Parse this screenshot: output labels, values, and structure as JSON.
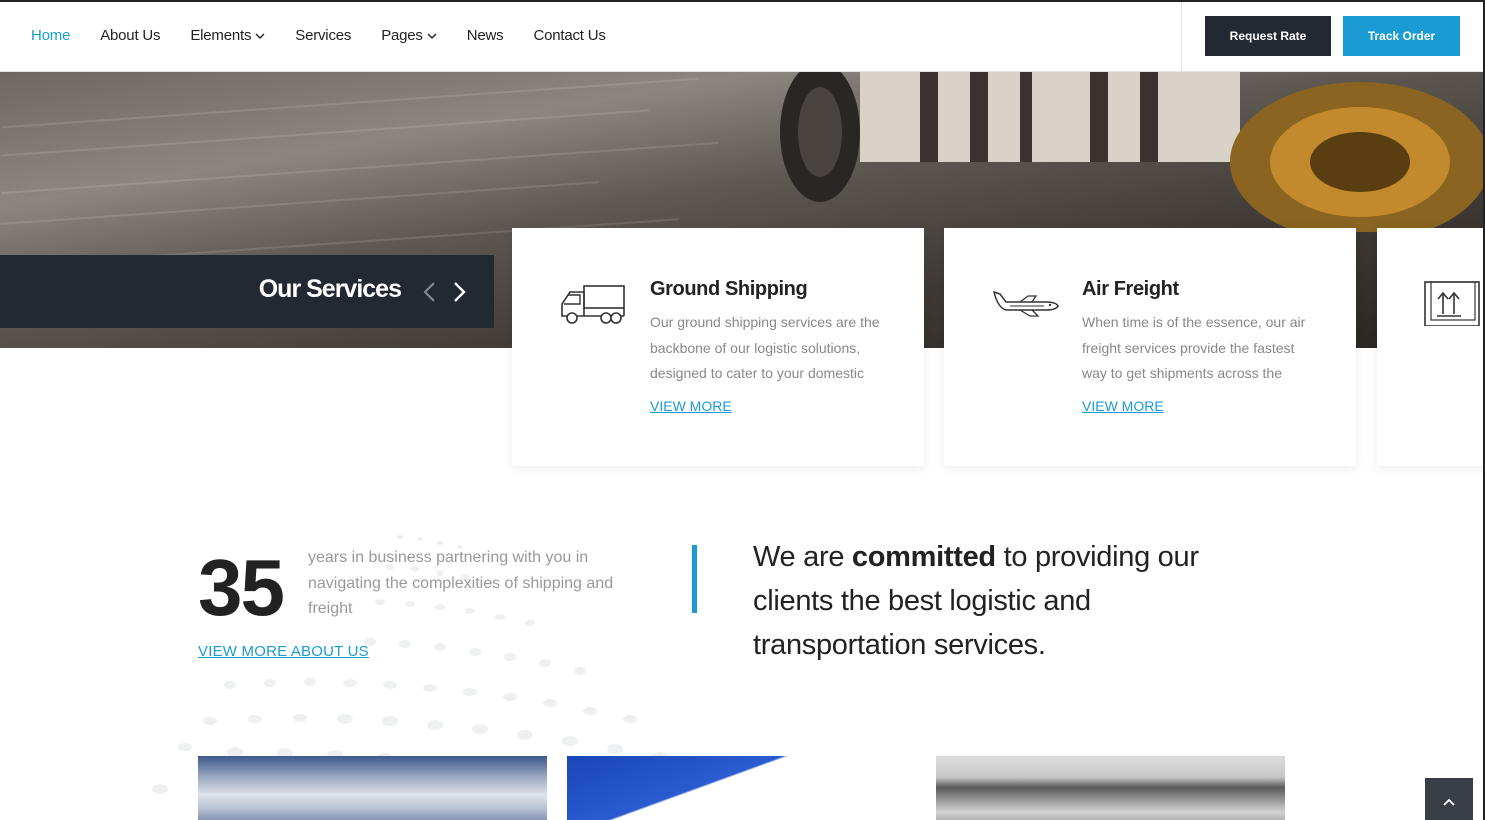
{
  "nav": {
    "items": [
      {
        "label": "Home",
        "active": true,
        "has_dropdown": false
      },
      {
        "label": "About Us",
        "active": false,
        "has_dropdown": false
      },
      {
        "label": "Elements",
        "active": false,
        "has_dropdown": true
      },
      {
        "label": "Services",
        "active": false,
        "has_dropdown": false
      },
      {
        "label": "Pages",
        "active": false,
        "has_dropdown": true
      },
      {
        "label": "News",
        "active": false,
        "has_dropdown": false
      },
      {
        "label": "Contact Us",
        "active": false,
        "has_dropdown": false
      }
    ],
    "request_rate_label": "Request Rate",
    "track_order_label": "Track Order"
  },
  "services": {
    "title": "Our Services",
    "cards": [
      {
        "icon": "truck-icon",
        "title": "Ground Shipping",
        "description": "Our ground shipping services are the backbone of our logistic solutions, designed to cater to your domestic",
        "link": "VIEW MORE"
      },
      {
        "icon": "plane-icon",
        "title": "Air Freight",
        "description": "When time is of the essence, our air freight services provide the fastest way to get shipments across the",
        "link": "VIEW MORE"
      },
      {
        "icon": "package-icon",
        "title": "",
        "description": "",
        "link": ""
      }
    ]
  },
  "about": {
    "years": "35",
    "years_text": "years in business partnering with you in navigating the complexities of shipping and freight",
    "link": "VIEW MORE ABOUT US",
    "commitment_prefix": "We are ",
    "commitment_bold": "committed",
    "commitment_suffix": " to providing our clients the best logistic and transportation services."
  },
  "colors": {
    "accent": "#1b9bd3",
    "dark": "#232933",
    "muted_text": "#888888"
  }
}
